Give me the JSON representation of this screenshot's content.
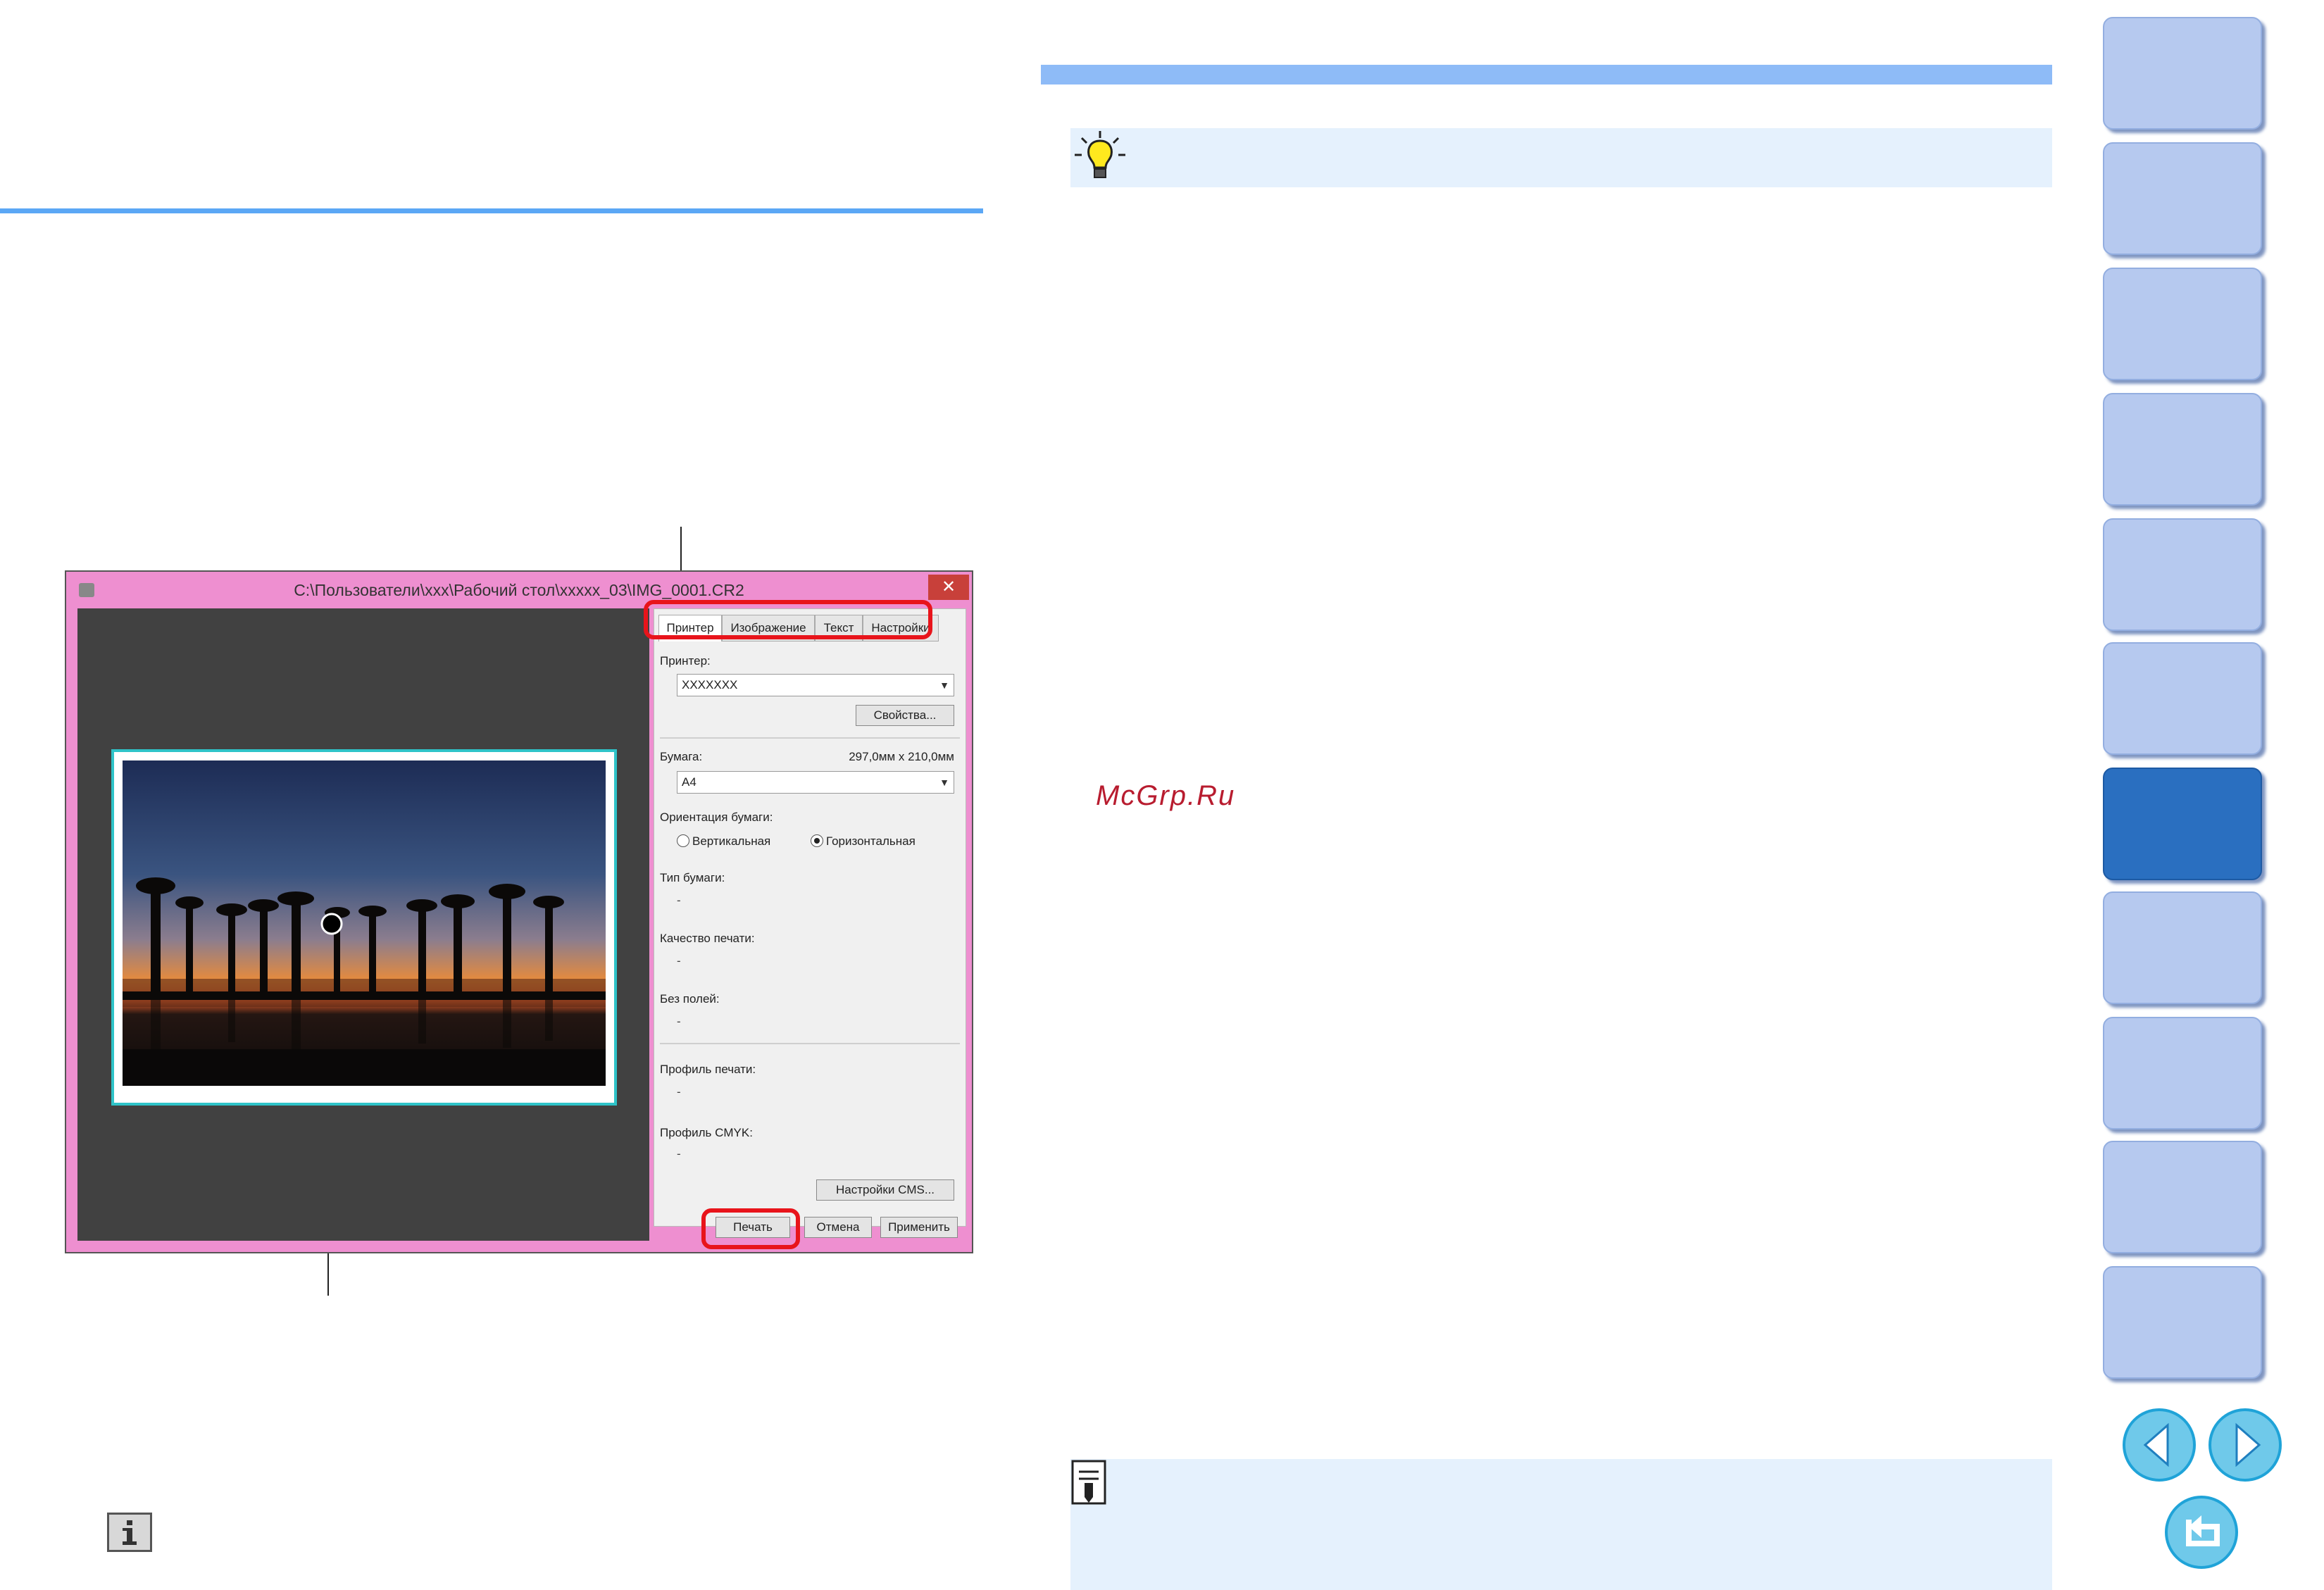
{
  "window": {
    "title": "C:\\Пользователи\\xxx\\Рабочий стол\\xxxxx_03\\IMG_0001.CR2",
    "close_glyph": "✕",
    "tabs": [
      {
        "label": "Принтер",
        "selected": true
      },
      {
        "label": "Изображение",
        "selected": false
      },
      {
        "label": "Текст",
        "selected": false
      },
      {
        "label": "Настройки",
        "selected": false
      }
    ],
    "printer": {
      "label": "Принтер:",
      "value": "XXXXXXX",
      "properties_button": "Свойства..."
    },
    "paper": {
      "label": "Бумага:",
      "size": "297,0мм x 210,0мм",
      "value": "A4"
    },
    "orientation": {
      "label": "Ориентация бумаги:",
      "portrait": "Вертикальная",
      "landscape": "Горизонтальная",
      "selected": "landscape"
    },
    "paper_type": {
      "label": "Тип бумаги:",
      "value": "-"
    },
    "print_quality": {
      "label": "Качество печати:",
      "value": "-"
    },
    "borderless": {
      "label": "Без полей:",
      "value": "-"
    },
    "print_profile": {
      "label": "Профиль печати:",
      "value": "-"
    },
    "cmyk_profile": {
      "label": "Профиль CMYK:",
      "value": "-"
    },
    "cms_button": "Настройки CMS...",
    "footer": {
      "print": "Печать",
      "cancel": "Отмена",
      "apply": "Применить"
    }
  },
  "watermark": "McGrp.Ru",
  "icons": {
    "tip": "lightbulb-icon",
    "note": "memo-icon",
    "info": "info-icon",
    "prev": "prev-page-icon",
    "next": "next-page-icon",
    "back": "return-icon"
  },
  "colors": {
    "accent_blue": "#5ba7f5",
    "highlight_red": "#e8141b",
    "window_frame": "#ee8fd0",
    "sidebar_tab": "#b6c9ef",
    "sidebar_current": "#2a6fc0"
  },
  "sidebar": {
    "tab_count": 11,
    "current_index": 6
  }
}
